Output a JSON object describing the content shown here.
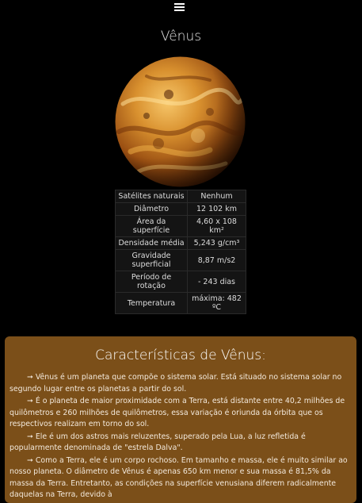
{
  "header": {
    "menu_icon": "hamburger-menu-icon"
  },
  "page": {
    "title": "Vênus"
  },
  "planet_image": {
    "alt": "Vênus",
    "colors": [
      "#f6c061",
      "#d48b2e",
      "#8a4310",
      "#4b1e05"
    ]
  },
  "info_table": {
    "rows": [
      {
        "label": "Satélites naturais",
        "value": "Nenhum"
      },
      {
        "label": "Diâmetro",
        "value": "12 102 km"
      },
      {
        "label": "Área da superfície",
        "value": "4,60 x 108 km²"
      },
      {
        "label": "Densidade média",
        "value": "5,243 g/cm³"
      },
      {
        "label": "Gravidade superficial",
        "value": "8,87 m/s2"
      },
      {
        "label": "Período de rotação",
        "value": "- 243 dias"
      },
      {
        "label": "Temperatura",
        "value": "máxima: 482 ºC"
      }
    ]
  },
  "characteristics": {
    "title": "Características de Vênus:",
    "bullet": "➞",
    "paragraphs": [
      "Vênus é um planeta que compõe o sistema solar. Está situado no sistema solar no segundo lugar entre os planetas a partir do sol.",
      "É o planeta de maior proximidade com a Terra, está distante entre 40,2 milhões de quilômetros e 260 milhões de quilômetros, essa variação é oriunda da órbita que os respectivos realizam em torno do sol.",
      "Ele é um dos astros mais reluzentes, superado pela Lua, a luz refletida é popularmente denominada de \"estrela Dalva\".",
      "Como a Terra, ele é um corpo rochoso. Em tamanho e massa, ele é muito similar ao nosso planeta. O diâmetro de Vênus é apenas 650 km menor e sua massa é 81,5% da massa da Terra. Entretanto, as condições na superfície venusiana diferem radicalmente daquelas na Terra, devido à"
    ]
  },
  "theme": {
    "background": "#000000",
    "card": "#7b4f19"
  }
}
